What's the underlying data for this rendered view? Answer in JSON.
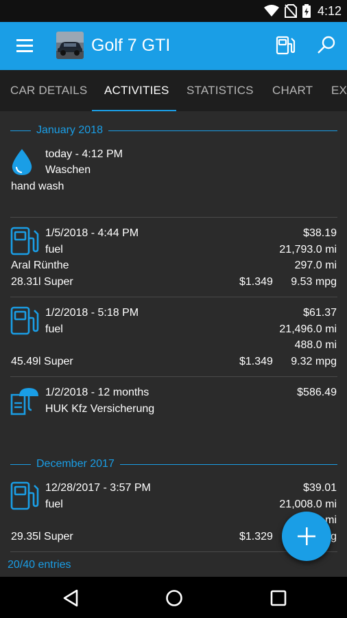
{
  "status_bar": {
    "time": "4:12"
  },
  "app_bar": {
    "title": "Golf 7 GTI"
  },
  "tabs": [
    {
      "label": "CAR DETAILS"
    },
    {
      "label": "ACTIVITIES",
      "active": true
    },
    {
      "label": "STATISTICS"
    },
    {
      "label": "CHART"
    },
    {
      "label": "EXTRAS"
    }
  ],
  "months": [
    {
      "label": "January 2018"
    },
    {
      "label": "December 2017"
    }
  ],
  "entries": [
    {
      "icon": "water-drop-icon",
      "datetime": "today - 4:12 PM",
      "type": "Waschen",
      "note": "hand wash"
    },
    {
      "icon": "fuel-pump-icon",
      "datetime": "1/5/2018 - 4:44 PM",
      "type": "fuel",
      "station": "Aral Rünthe",
      "volume": "28.31l Super",
      "cost": "$38.19",
      "odometer": "21,793.0 mi",
      "distance": "297.0 mi",
      "price": "$1.349",
      "economy": "9.53 mpg"
    },
    {
      "icon": "fuel-pump-icon",
      "datetime": "1/2/2018 - 5:18 PM",
      "type": "fuel",
      "volume": "45.49l Super",
      "cost": "$61.37",
      "odometer": "21,496.0 mi",
      "distance": "488.0 mi",
      "price": "$1.349",
      "economy": "9.32 mpg"
    },
    {
      "icon": "insurance-umbrella-icon",
      "datetime": "1/2/2018 - 12 months",
      "type": "HUK Kfz Versicherung",
      "cost": "$586.49"
    },
    {
      "icon": "fuel-pump-icon",
      "datetime": "12/28/2017 - 3:57 PM",
      "type": "fuel",
      "volume": "29.35l Super",
      "cost": "$39.01",
      "odometer": "21,008.0 mi",
      "distance": "mi",
      "price": "$1.329",
      "economy": "g"
    }
  ],
  "footer": {
    "count": "20/40 entries"
  },
  "colors": {
    "accent": "#1a9ee6",
    "background": "#2b2b2b",
    "tab_bar": "#1e1e1e"
  }
}
